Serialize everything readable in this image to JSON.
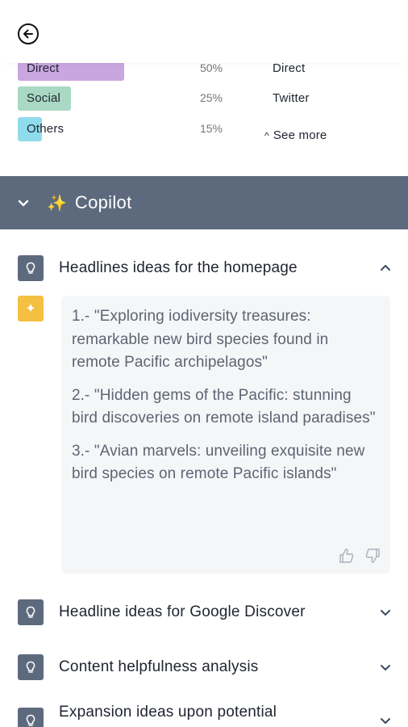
{
  "traffic": {
    "rows": [
      {
        "label": "Direct",
        "percent": "50%",
        "color": "#c9a6e0",
        "bar_fraction": 1.0
      },
      {
        "label": "Social",
        "percent": "25%",
        "color": "#a9d8c4",
        "bar_fraction": 0.5
      },
      {
        "label": "Others",
        "percent": "15%",
        "color": "#8fdcec",
        "bar_fraction": 0.23
      }
    ],
    "right_column": [
      "Direct",
      "Twitter"
    ],
    "see_more": "See more"
  },
  "copilot": {
    "title": "Copilot",
    "header_color": "#5d6a7e",
    "items": [
      {
        "title": "Headlines ideas for the homepage",
        "expanded": true
      },
      {
        "title": "Headline ideas for Google Discover",
        "expanded": false
      },
      {
        "title": "Content helpfulness analysis",
        "expanded": false
      },
      {
        "title": "Expansion ideas upon potential",
        "expanded": false
      }
    ],
    "ideas": [
      "1.- \"Exploring iodiversity treasures: remarkable new bird species found in remote Pacific archipelagos\"",
      "2.- \"Hidden gems of the Pacific: stunning bird discoveries on remote island paradises\"",
      "3.- \"Avian marvels: unveiling exquisite new bird species on remote Pacific islands\""
    ]
  }
}
